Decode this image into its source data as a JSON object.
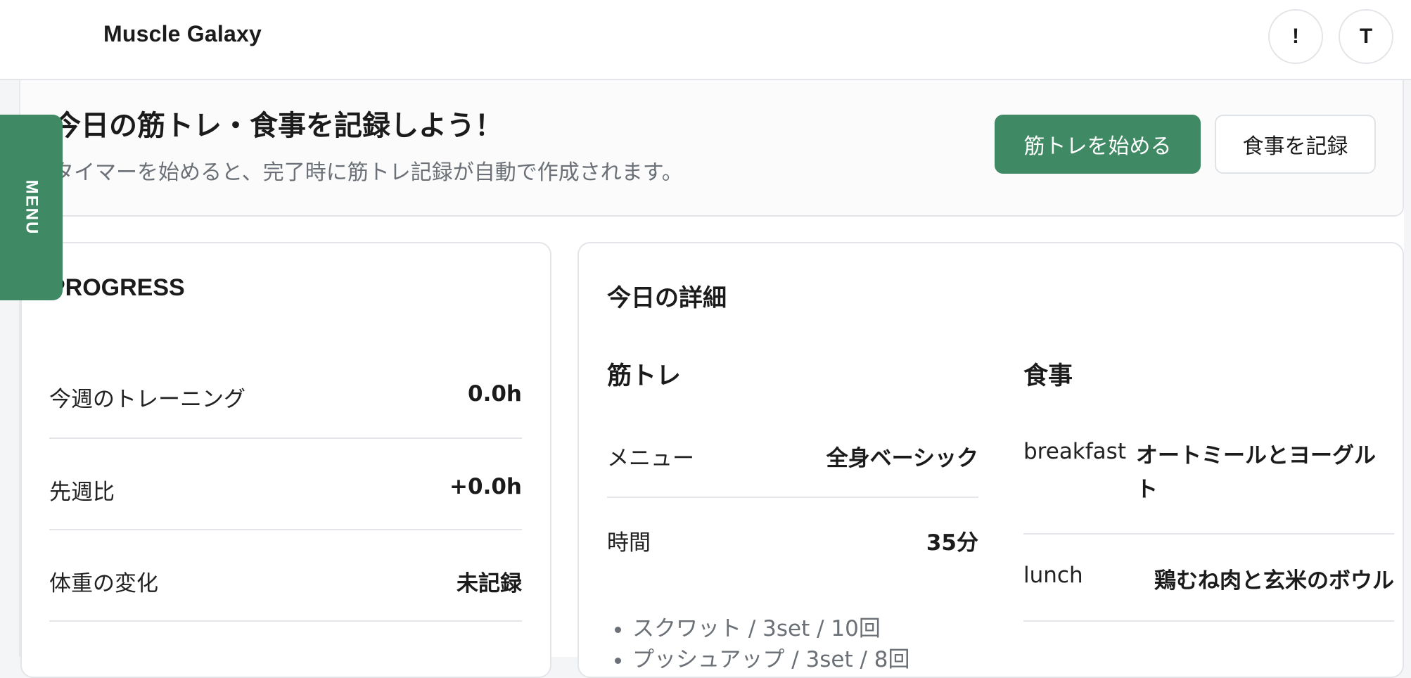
{
  "header": {
    "brand": "Muscle Galaxy",
    "alert_label": "!",
    "user_initial": "T"
  },
  "side_menu": {
    "label": "MENU"
  },
  "hero": {
    "title": "今日の筋トレ・食事を記録しよう！",
    "subtitle": "タイマーを始めると、完了時に筋トレ記録が自動で作成されます。",
    "primary_button": "筋トレを始める",
    "secondary_button": "食事を記録"
  },
  "progress": {
    "title": "PROGRESS",
    "rows": [
      {
        "label": "今週のトレーニング",
        "value": "0.0h"
      },
      {
        "label": "先週比",
        "value": "+0.0h"
      },
      {
        "label": "体重の変化",
        "value": "未記録"
      }
    ]
  },
  "today_detail": {
    "title": "今日の詳細",
    "training": {
      "title": "筋トレ",
      "rows": [
        {
          "label": "メニュー",
          "value": "全身ベーシック"
        },
        {
          "label": "時間",
          "value": "35分"
        }
      ],
      "exercises": [
        "スクワット / 3set / 10回",
        "プッシュアップ / 3set / 8回"
      ]
    },
    "meal": {
      "title": "食事",
      "rows": [
        {
          "label": "breakfast",
          "value_line1": "オートミールとヨーグル",
          "value_line2": "ト"
        },
        {
          "label": "lunch",
          "value": "鶏むね肉と玄米のボウル"
        }
      ]
    }
  },
  "colors": {
    "accent": "#3f8a64",
    "border": "#e3e5e8",
    "muted_text": "#6b7076"
  }
}
